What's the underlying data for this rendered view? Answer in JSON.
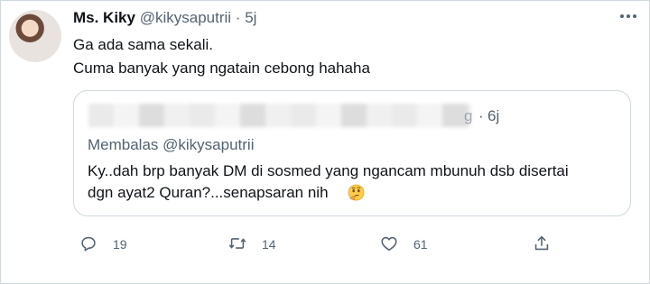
{
  "tweet": {
    "display_name": "Ms. Kiky",
    "handle": "@kikysaputrii",
    "separator": "·",
    "time": "5j",
    "lines": [
      "Ga ada sama sekali.",
      "Cuma banyak yang ngatain cebong hahaha"
    ]
  },
  "quote": {
    "handle_tail": "g",
    "separator": "·",
    "time": "6j",
    "replying_to": "Membalas @kikysaputrii",
    "lines": [
      "Ky..dah brp banyak DM di sosmed yang ngancam mbunuh dsb disertai",
      "dgn ayat2 Quran?...senapsaran nih"
    ],
    "emoji": "thinking-face-icon"
  },
  "actions": {
    "reply_count": "19",
    "retweet_count": "14",
    "like_count": "61"
  },
  "colors": {
    "text": "#0f1419",
    "secondary": "#536471",
    "border": "#cfd9de"
  }
}
